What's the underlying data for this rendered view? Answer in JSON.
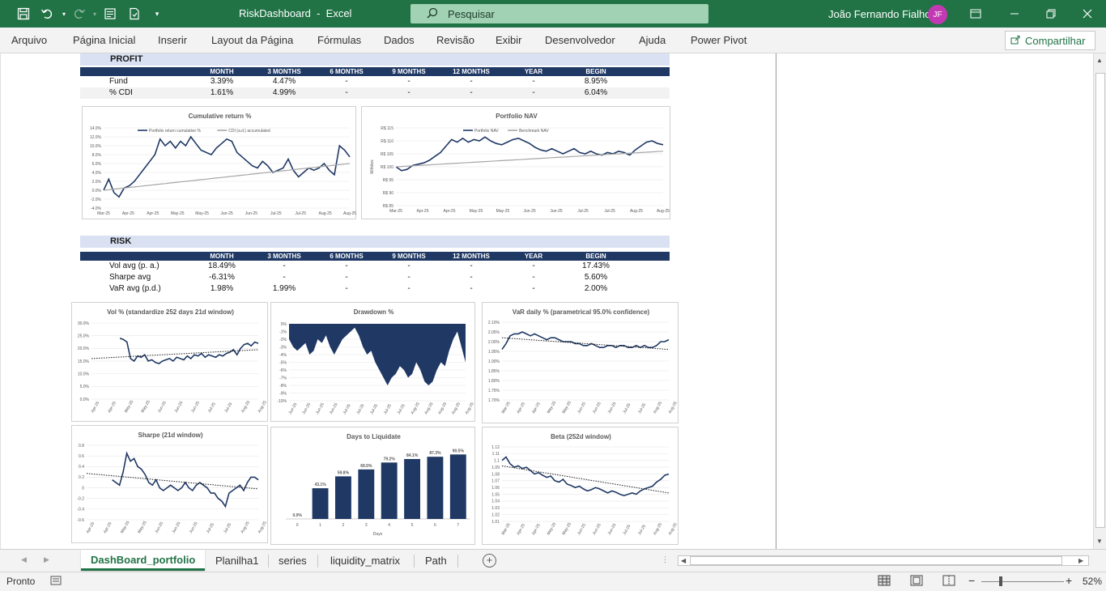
{
  "titlebar": {
    "title": "RiskDashboard  -  Excel",
    "search_placeholder": "Pesquisar",
    "user_name": "João Fernando Fialho",
    "avatar_initials": "JF",
    "colors": {
      "bar": "#217346",
      "search": "#a1d2b3",
      "avatar": "#c239b3"
    }
  },
  "ribbon": {
    "tabs": [
      "Arquivo",
      "Página Inicial",
      "Inserir",
      "Layout da Página",
      "Fórmulas",
      "Dados",
      "Revisão",
      "Exibir",
      "Desenvolvedor",
      "Ajuda",
      "Power Pivot"
    ],
    "share_label": "Compartilhar"
  },
  "profit": {
    "title": "PROFIT",
    "columns": [
      "MONTH",
      "3 MONTHS",
      "6 MONTHS",
      "9 MONTHS",
      "12 MONTHS",
      "YEAR",
      "BEGIN"
    ],
    "rows": [
      {
        "label": "Fund",
        "values": [
          "3.39%",
          "4.47%",
          "-",
          "-",
          "-",
          "-",
          "8.95%"
        ]
      },
      {
        "label": "% CDI",
        "values": [
          "1.61%",
          "4.99%",
          "-",
          "-",
          "-",
          "-",
          "6.04%"
        ]
      }
    ]
  },
  "risk": {
    "title": "RISK",
    "columns": [
      "MONTH",
      "3 MONTHS",
      "6 MONTHS",
      "9 MONTHS",
      "12 MONTHS",
      "YEAR",
      "BEGIN"
    ],
    "rows": [
      {
        "label": "Vol avg (p. a.)",
        "values": [
          "18.49%",
          "-",
          "-",
          "-",
          "-",
          "-",
          "17.43%"
        ]
      },
      {
        "label": "Sharpe avg",
        "values": [
          "-6.31%",
          "-",
          "-",
          "-",
          "-",
          "-",
          "5.60%"
        ]
      },
      {
        "label": "VaR avg (p.d.)",
        "values": [
          "1.98%",
          "1.99%",
          "-",
          "-",
          "-",
          "-",
          "2.00%"
        ]
      }
    ]
  },
  "chart_data": [
    {
      "type": "line",
      "title": "Cumulative return %",
      "x_ticks": [
        "Mar-25",
        "Apr-25",
        "Apr-25",
        "May-25",
        "May-25",
        "Jun-25",
        "Jun-25",
        "Jul-25",
        "Jul-25",
        "Aug-25",
        "Aug-25"
      ],
      "y_ticks": [
        "14.0%",
        "12.0%",
        "10.0%",
        "8.0%",
        "6.0%",
        "4.0%",
        "2.0%",
        "0.0%",
        "-2.0%",
        "-4.0%"
      ],
      "ylim": [
        -4,
        14
      ],
      "series": [
        {
          "name": "Portfolio return cumulative %",
          "color": "#1f3864",
          "values": [
            0,
            2.5,
            -0.5,
            -1.5,
            0.5,
            1.0,
            2.0,
            3.5,
            5.0,
            6.5,
            8.0,
            11.5,
            10.0,
            11.0,
            9.5,
            11.0,
            10.0,
            12.0,
            10.5,
            9.0,
            8.5,
            8.0,
            9.5,
            10.5,
            11.5,
            11.0,
            8.5,
            7.5,
            6.5,
            5.5,
            5.0,
            6.5,
            5.5,
            4.0,
            4.5,
            5.0,
            7.0,
            4.5,
            3.0,
            4.0,
            5.0,
            4.5,
            5.0,
            6.0,
            4.5,
            3.5,
            10.0,
            9.0,
            7.5
          ]
        },
        {
          "name": "CDI (a.d.) accumulated",
          "color": "#a6a6a6",
          "values": [
            0,
            0.13,
            0.25,
            0.38,
            0.5,
            0.63,
            0.75,
            0.88,
            1.0,
            1.13,
            1.25,
            1.38,
            1.5,
            1.63,
            1.75,
            1.88,
            2.0,
            2.13,
            2.25,
            2.38,
            2.5,
            2.63,
            2.75,
            2.88,
            3.0,
            3.13,
            3.25,
            3.38,
            3.5,
            3.63,
            3.75,
            3.88,
            4.0,
            4.13,
            4.25,
            4.38,
            4.5,
            4.63,
            4.75,
            4.88,
            5.0,
            5.13,
            5.25,
            5.38,
            5.5,
            5.63,
            5.75,
            5.88,
            6.0
          ]
        }
      ]
    },
    {
      "type": "line",
      "title": "Portfolio NAV",
      "ylabel": "Milhões",
      "x_ticks": [
        "Mar-25",
        "Apr-25",
        "Apr-25",
        "May-25",
        "May-25",
        "Jun-25",
        "Jun-25",
        "Jul-25",
        "Jul-25",
        "Aug-25",
        "Aug-25"
      ],
      "y_ticks": [
        "R$ 115",
        "R$ 110",
        "R$ 105",
        "R$ 100",
        "R$ 95",
        "R$ 90",
        "R$ 85"
      ],
      "ylim": [
        85,
        115
      ],
      "series": [
        {
          "name": "Portfolio NAV",
          "color": "#1f3864",
          "values": [
            100,
            98.5,
            99.0,
            100.5,
            101.0,
            101.5,
            102.5,
            104.0,
            105.5,
            108.0,
            110.5,
            109.5,
            111.0,
            109.5,
            110.5,
            110.0,
            111.5,
            110.0,
            109.0,
            108.5,
            109.5,
            110.5,
            111.0,
            110.0,
            109.0,
            107.5,
            106.5,
            106.0,
            107.0,
            106.0,
            105.0,
            106.0,
            107.0,
            105.5,
            105.0,
            106.0,
            105.0,
            104.5,
            105.5,
            105.0,
            106.0,
            105.5,
            104.5,
            106.5,
            108.0,
            109.5,
            110.0,
            109.0,
            108.5
          ]
        },
        {
          "name": "Benchmark NAV",
          "color": "#a6a6a6",
          "values": [
            100,
            100.13,
            100.25,
            100.38,
            100.5,
            100.63,
            100.75,
            100.88,
            101.0,
            101.13,
            101.25,
            101.38,
            101.5,
            101.63,
            101.75,
            101.88,
            102.0,
            102.13,
            102.25,
            102.38,
            102.5,
            102.63,
            102.75,
            102.88,
            103.0,
            103.13,
            103.25,
            103.38,
            103.5,
            103.63,
            103.75,
            103.88,
            104.0,
            104.13,
            104.25,
            104.38,
            104.5,
            104.63,
            104.75,
            104.88,
            105.0,
            105.13,
            105.25,
            105.38,
            105.5,
            105.63,
            105.75,
            105.88,
            106.0
          ]
        }
      ]
    },
    {
      "type": "line",
      "title": "Vol % (standardize 252 days 21d window)",
      "x_ticks": [
        "Apr-25",
        "Apr-25",
        "May-25",
        "May-25",
        "Jun-25",
        "Jun-25",
        "Jun-25",
        "Jul-25",
        "Jul-25",
        "Aug-25",
        "Aug-25"
      ],
      "y_ticks": [
        "30.0%",
        "25.0%",
        "20.0%",
        "15.0%",
        "10.0%",
        "5.0%",
        "0.0%"
      ],
      "ylim": [
        0,
        30
      ],
      "series": [
        {
          "name": "",
          "color": "#1f3864",
          "values": [
            null,
            null,
            null,
            null,
            null,
            null,
            null,
            null,
            24.0,
            23.5,
            22.5,
            16.0,
            15.0,
            17.0,
            16.5,
            17.5,
            15.0,
            15.5,
            14.5,
            14.0,
            15.0,
            15.5,
            16.0,
            15.0,
            16.5,
            16.0,
            15.5,
            17.0,
            16.0,
            17.5,
            17.0,
            18.0,
            16.5,
            17.5,
            17.0,
            16.5,
            17.5,
            17.0,
            18.0,
            18.5,
            19.5,
            17.5,
            20.0,
            21.5,
            22.0,
            21.0,
            22.5,
            22.0
          ]
        },
        {
          "name": "",
          "color": "#1a1a1a",
          "values": [
            16.0,
            19.5
          ]
        }
      ]
    },
    {
      "type": "area",
      "title": "Drawdown %",
      "x_ticks": [
        "Jun-25",
        "Jun-25",
        "Jun-25",
        "Jun-25",
        "Jul-25",
        "Jul-25",
        "Jul-25",
        "Jul-25",
        "Jul-25",
        "Aug-25",
        "Aug-25",
        "Aug-25",
        "Aug-25",
        "Aug-25"
      ],
      "y_ticks": [
        "0%",
        "-1%",
        "-2%",
        "-3%",
        "-4%",
        "-5%",
        "-6%",
        "-7%",
        "-8%",
        "-9%",
        "-10%"
      ],
      "ylim": [
        -10,
        0
      ],
      "series": [
        {
          "name": "",
          "color": "#1f3864",
          "values": [
            -2.0,
            -3.0,
            -3.5,
            -3.0,
            -2.5,
            -4.0,
            -3.5,
            -2.0,
            -2.5,
            -1.5,
            -3.0,
            -4.0,
            -3.0,
            -2.0,
            -1.5,
            -1.0,
            -0.5,
            -1.5,
            -3.0,
            -4.0,
            -3.5,
            -5.0,
            -6.0,
            -7.0,
            -8.0,
            -7.0,
            -6.5,
            -5.5,
            -6.0,
            -7.0,
            -6.5,
            -5.0,
            -6.0,
            -7.5,
            -8.0,
            -7.5,
            -6.0,
            -5.0,
            -5.5,
            -3.5,
            -2.0,
            -1.0,
            -3.0,
            -5.0
          ]
        }
      ]
    },
    {
      "type": "line",
      "title": "VaR daily % (parametrical 95.0% confidence)",
      "x_ticks": [
        "Mar-25",
        "Apr-25",
        "Apr-25",
        "May-25",
        "May-25",
        "Jun-25",
        "Jun-25",
        "Jun-25",
        "Jul-25",
        "Jul-25",
        "Aug-25",
        "Aug-25"
      ],
      "y_ticks": [
        "2.10%",
        "2.05%",
        "2.00%",
        "1.95%",
        "1.90%",
        "1.85%",
        "1.80%",
        "1.75%",
        "1.70%"
      ],
      "ylim": [
        1.7,
        2.1
      ],
      "series": [
        {
          "name": "",
          "color": "#1f3864",
          "values": [
            1.96,
            1.99,
            2.03,
            2.04,
            2.04,
            2.05,
            2.04,
            2.03,
            2.04,
            2.03,
            2.02,
            2.01,
            2.02,
            2.02,
            2.01,
            2.0,
            2.0,
            2.0,
            1.99,
            1.99,
            1.98,
            1.98,
            1.99,
            1.98,
            1.97,
            1.97,
            1.98,
            1.98,
            1.97,
            1.98,
            1.98,
            1.97,
            1.97,
            1.98,
            1.97,
            1.98,
            1.97,
            1.97,
            1.98,
            2.0,
            2.0,
            2.01
          ]
        },
        {
          "name": "",
          "color": "#1a1a1a",
          "values": [
            2.02,
            1.96
          ]
        }
      ]
    },
    {
      "type": "line",
      "title": "Sharpe (21d window)",
      "x_ticks": [
        "Apr-25",
        "Apr-25",
        "May-25",
        "May-25",
        "Jun-25",
        "Jun-25",
        "Jun-25",
        "Jul-25",
        "Jul-25",
        "Aug-25",
        "Aug-25"
      ],
      "y_ticks": [
        "0.8",
        "0.6",
        "0.4",
        "0.2",
        "0",
        "-0.2",
        "-0.4",
        "-0.6"
      ],
      "ylim": [
        -0.6,
        0.8
      ],
      "series": [
        {
          "name": "",
          "color": "#1f3864",
          "values": [
            null,
            null,
            null,
            null,
            null,
            null,
            null,
            0.15,
            0.1,
            0.05,
            0.3,
            0.65,
            0.5,
            0.55,
            0.4,
            0.35,
            0.25,
            0.1,
            0.05,
            0.15,
            0.0,
            -0.05,
            0.0,
            0.05,
            0.0,
            -0.05,
            0.0,
            0.1,
            0.0,
            -0.05,
            0.05,
            0.1,
            0.05,
            0.0,
            -0.1,
            -0.1,
            -0.2,
            -0.25,
            -0.35,
            -0.1,
            -0.05,
            0.0,
            0.05,
            -0.05,
            0.1,
            0.2,
            0.2,
            0.15
          ]
        },
        {
          "name": "",
          "color": "#1a1a1a",
          "values": [
            0.27,
            -0.02
          ]
        }
      ]
    },
    {
      "type": "bar",
      "title": "Days to Liquidate",
      "xlabel": "Days",
      "categories": [
        "0",
        "1",
        "2",
        "3",
        "4",
        "5",
        "6",
        "7"
      ],
      "values": [
        0.0,
        43.1,
        59.8,
        69.5,
        79.2,
        84.1,
        87.3,
        90.5
      ],
      "labels": [
        "0.0%",
        "43.1%",
        "59.8%",
        "69.5%",
        "79.2%",
        "84.1%",
        "87.3%",
        "90.5%"
      ],
      "ylim": [
        0,
        100
      ]
    },
    {
      "type": "line",
      "title": "Beta (252d window)",
      "x_ticks": [
        "Mar-25",
        "Apr-25",
        "Apr-25",
        "May-25",
        "May-25",
        "Jun-25",
        "Jun-25",
        "Jun-25",
        "Jul-25",
        "Jul-25",
        "Aug-25",
        "Aug-25"
      ],
      "y_ticks": [
        "1.12",
        "1.11",
        "1.1",
        "1.09",
        "1.08",
        "1.07",
        "1.06",
        "1.05",
        "1.04",
        "1.03",
        "1.02",
        "1.01"
      ],
      "ylim": [
        1.01,
        1.12
      ],
      "series": [
        {
          "name": "",
          "color": "#1f3864",
          "values": [
            1.1,
            1.105,
            1.095,
            1.09,
            1.092,
            1.088,
            1.09,
            1.085,
            1.08,
            1.082,
            1.078,
            1.075,
            1.077,
            1.07,
            1.068,
            1.072,
            1.065,
            1.063,
            1.06,
            1.062,
            1.058,
            1.055,
            1.057,
            1.06,
            1.058,
            1.055,
            1.052,
            1.055,
            1.053,
            1.05,
            1.048,
            1.05,
            1.052,
            1.05,
            1.055,
            1.058,
            1.06,
            1.062,
            1.068,
            1.072,
            1.078,
            1.08
          ]
        },
        {
          "name": "",
          "color": "#1a1a1a",
          "values": [
            1.092,
            1.052
          ]
        }
      ]
    }
  ],
  "sheet_tabs": {
    "tabs": [
      "DashBoard_portfolio",
      "Planilha1",
      "series",
      "liquidity_matrix",
      "Path"
    ],
    "active": "DashBoard_portfolio"
  },
  "statusbar": {
    "mode": "Pronto",
    "zoom": "52%"
  }
}
